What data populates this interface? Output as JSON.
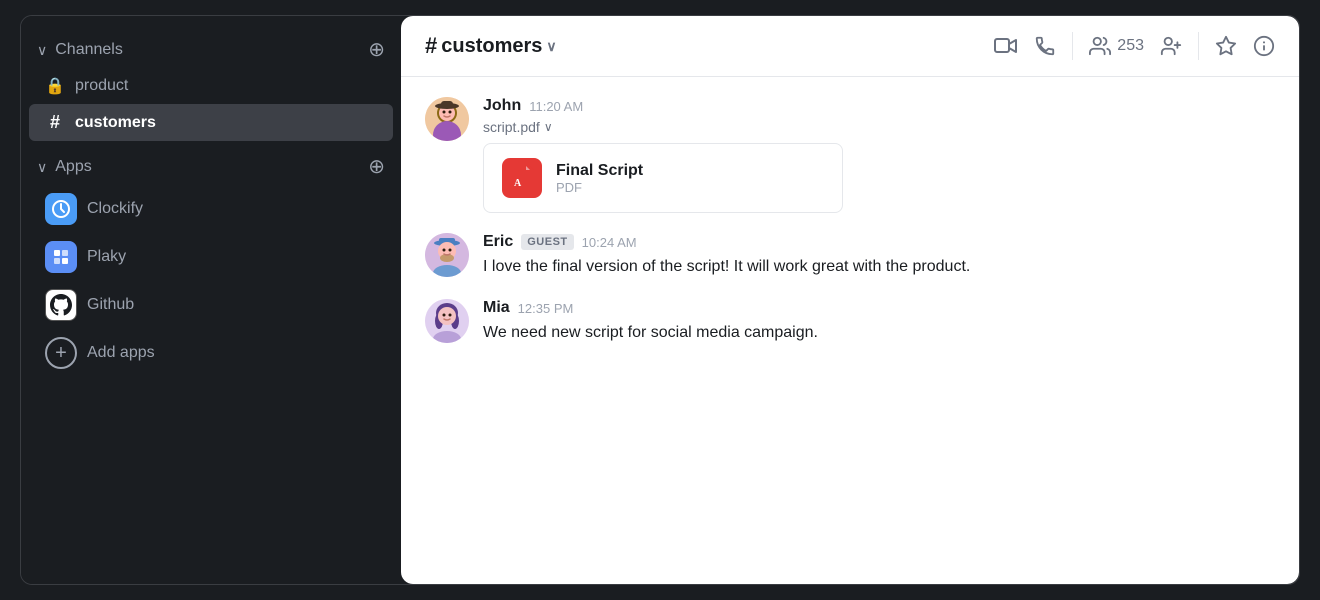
{
  "sidebar": {
    "channels_section": {
      "title": "Channels",
      "items": [
        {
          "id": "product",
          "label": "product",
          "icon": "lock"
        },
        {
          "id": "customers",
          "label": "customers",
          "icon": "hash",
          "active": true
        }
      ]
    },
    "apps_section": {
      "title": "Apps",
      "items": [
        {
          "id": "clockify",
          "label": "Clockify"
        },
        {
          "id": "plaky",
          "label": "Plaky"
        },
        {
          "id": "github",
          "label": "Github"
        }
      ],
      "add_label": "Add apps"
    }
  },
  "channel": {
    "name": "customers",
    "members_count": "253"
  },
  "messages": [
    {
      "id": "msg1",
      "sender": "John",
      "time": "11:20 AM",
      "avatar_color": "#f0c8a0",
      "avatar_emoji": "🧑",
      "attachment_label": "script.pdf",
      "file": {
        "name": "Final Script",
        "type": "PDF"
      }
    },
    {
      "id": "msg2",
      "sender": "Eric",
      "is_guest": true,
      "guest_label": "GUEST",
      "time": "10:24 AM",
      "avatar_color": "#c8b8d8",
      "avatar_emoji": "👨",
      "text": "I love the final version of the script! It will work great with the product."
    },
    {
      "id": "msg3",
      "sender": "Mia",
      "time": "12:35 PM",
      "avatar_color": "#e0d0f0",
      "avatar_emoji": "👩",
      "text": "We need new script for social media campaign."
    }
  ],
  "icons": {
    "chevron_down": "∨",
    "add": "+",
    "dropdown": "∨",
    "video": "📹",
    "phone": "📞",
    "members": "👥",
    "add_member": "👤+",
    "pin": "📌",
    "info": "ⓘ",
    "lock": "🔒",
    "hash": "#",
    "pdf": "A"
  }
}
